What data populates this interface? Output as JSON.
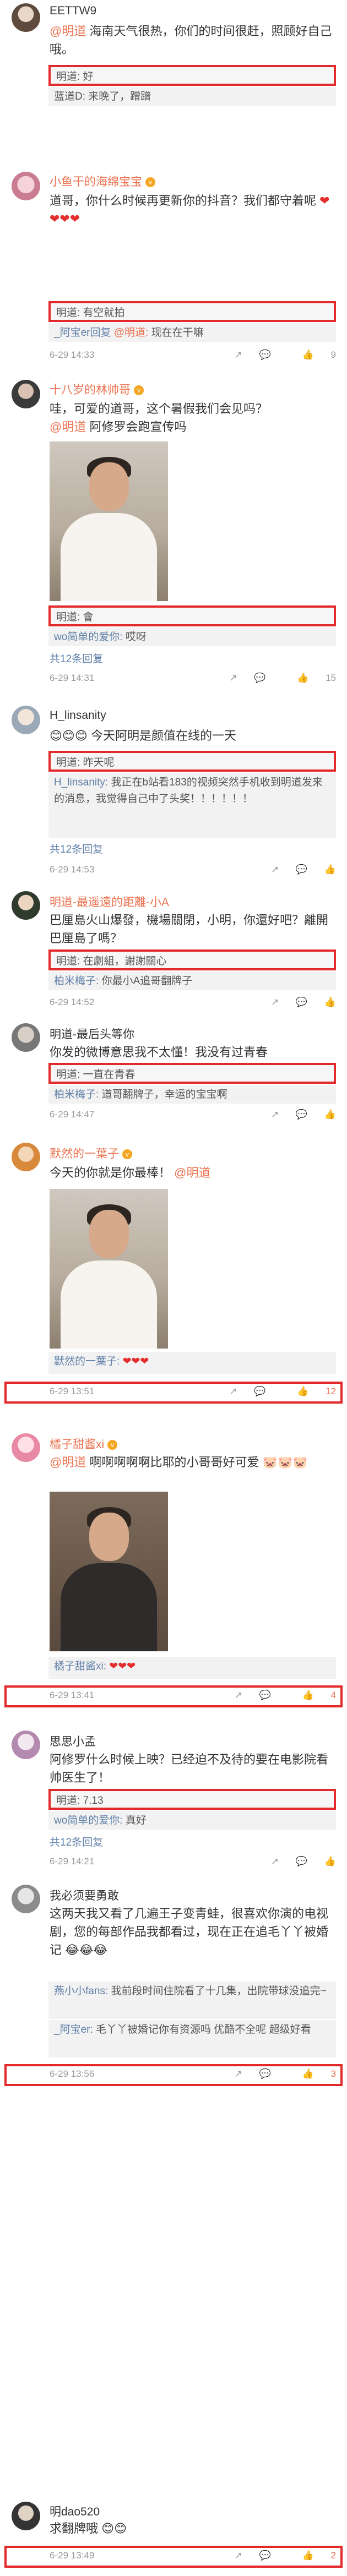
{
  "c1": {
    "name": "EETTW9",
    "text": "海南天气很热，你们的时间很赶，照顾好自己哦。",
    "mention": "@明道",
    "reply1": "明道: 好",
    "reply2": "蓝道D: 来晚了，蹭蹭"
  },
  "c2": {
    "name": "小鱼干的海绵宝宝",
    "text": "道哥，你什么时候再更新你的抖音？我们都守着呢",
    "reply1": "明道: 有空就拍",
    "reply2_name": "_阿宝er回复",
    "reply2_mention": "@明道:",
    "reply2_text": "现在在干嘛",
    "time": "6-29 14:33",
    "likes": "9"
  },
  "c3": {
    "name": "十八岁的林帅哥",
    "text": "哇，可爱的道哥，这个暑假我们会见吗？",
    "mention": "@明道",
    "text2": "阿修罗会跑宣传吗",
    "reply1": "明道: 會",
    "reply2_name": "wo简单的爱你:",
    "reply2_text": "哎呀",
    "more": "共12条回复",
    "time": "6-29 14:31",
    "likes": "15"
  },
  "c4": {
    "name": "H_linsanity",
    "text": "今天阿明是颜值在线的一天",
    "reply1": "明道: 昨天呢",
    "reply2_name": "H_linsanity:",
    "reply2_text": "我正在b站看183的视频突然手机收到明道发来的消息，我觉得自己中了头奖！！！！！！",
    "more": "共12条回复",
    "time": "6-29 14:53"
  },
  "c5": {
    "name": "明道-最遥遠的距離-小A",
    "text": "巴厘島火山爆發，機場關閉，小明，你還好吧？離開巴厘島了嗎？",
    "reply1": "明道: 在劇組，謝謝關心",
    "reply2_name": "柏米梅子:",
    "reply2_text": "你最小A追哥翻牌子",
    "time": "6-29 14:52"
  },
  "c6": {
    "name": "明道-最后头等你",
    "text": "你发的微博意思我不太懂！我没有过青春",
    "reply1": "明道: 一直在青春",
    "reply2_name": "柏米梅子:",
    "reply2_text": "道哥翻牌子，幸运的宝宝啊",
    "time": "6-29 14:47"
  },
  "c7": {
    "name": "默然的一葉子",
    "text": "今天的你就是你最棒！",
    "mention": "@明道",
    "reply_footer": "默然的一葉子:",
    "time": "6-29 13:51",
    "likes": "12"
  },
  "c8": {
    "name": "橘子甜酱xi",
    "mention": "@明道",
    "text": "啊啊啊啊啊比耶的小哥哥好可爱",
    "reply_footer": "橘子甜酱xi:",
    "time": "6-29 13:41",
    "likes": "4"
  },
  "c9": {
    "name": "思思小孟",
    "text": "阿修罗什么时候上映？已经迫不及待的要在电影院看帅医生了！",
    "reply1": "明道: 7.13",
    "reply2_name": "wo简单的爱你:",
    "reply2_text": "真好",
    "more": "共12条回复",
    "time": "6-29 14:21"
  },
  "c10": {
    "name": "我必须要勇敢",
    "text": "这两天我又看了几遍王子变青蛙，很喜欢你演的电视剧，您的每部作品我都看过，现在正在追毛丫丫被婚记",
    "reply1_name": "燕小小fans:",
    "reply1_text": "我前段时间住院看了十几集，出院带球没追完~",
    "reply2_name": "_阿宝er:",
    "reply2_text": "毛丫丫被婚记你有资源吗 优酷不全呢 超级好看",
    "time": "6-29 13:56",
    "likes": "3"
  },
  "c11": {
    "name": "明dao520",
    "text": "求翻牌哦",
    "time": "6-29 13:49",
    "likes": "2"
  },
  "ui": {
    "share_glyph": "↗",
    "comment_glyph": "💬",
    "like_glyph": "👍"
  },
  "colors": {
    "highlight_frame": "#e32a2a",
    "accent": "#eb7350",
    "link_blue": "#5f7fa8"
  }
}
